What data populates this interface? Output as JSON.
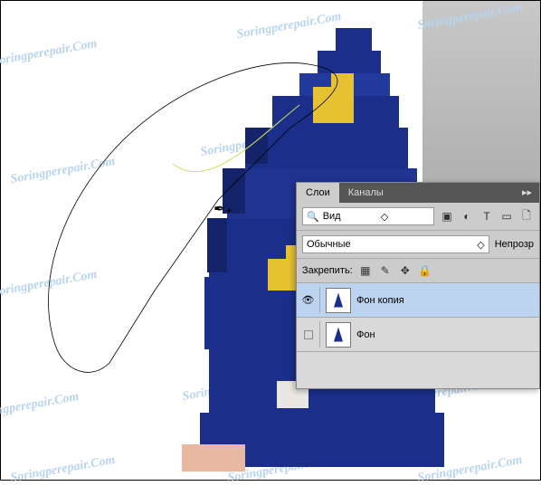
{
  "watermark_text": "Soringperepair.Com",
  "panel": {
    "tabs": {
      "layers": "Слои",
      "channels": "Каналы"
    },
    "search": {
      "placeholder": "Вид"
    },
    "blend_mode": "Обычные",
    "opacity_label": "Непрозр",
    "lock_label": "Закрепить:",
    "layers": [
      {
        "name": "Фон копия",
        "visible": true,
        "selected": true
      },
      {
        "name": "Фон",
        "visible": false,
        "selected": false
      }
    ]
  },
  "icons": {
    "menu": "▸▸",
    "search": "🔍",
    "dropdown": "◇",
    "image_filter": "▣",
    "adjust_filter": "◐",
    "type_filter": "T",
    "shape_filter": "▭",
    "smart_filter": "🗋",
    "lock_pixels": "▦",
    "lock_brush": "✎",
    "lock_move": "✥",
    "lock_all": "🔒",
    "eye": "👁"
  }
}
